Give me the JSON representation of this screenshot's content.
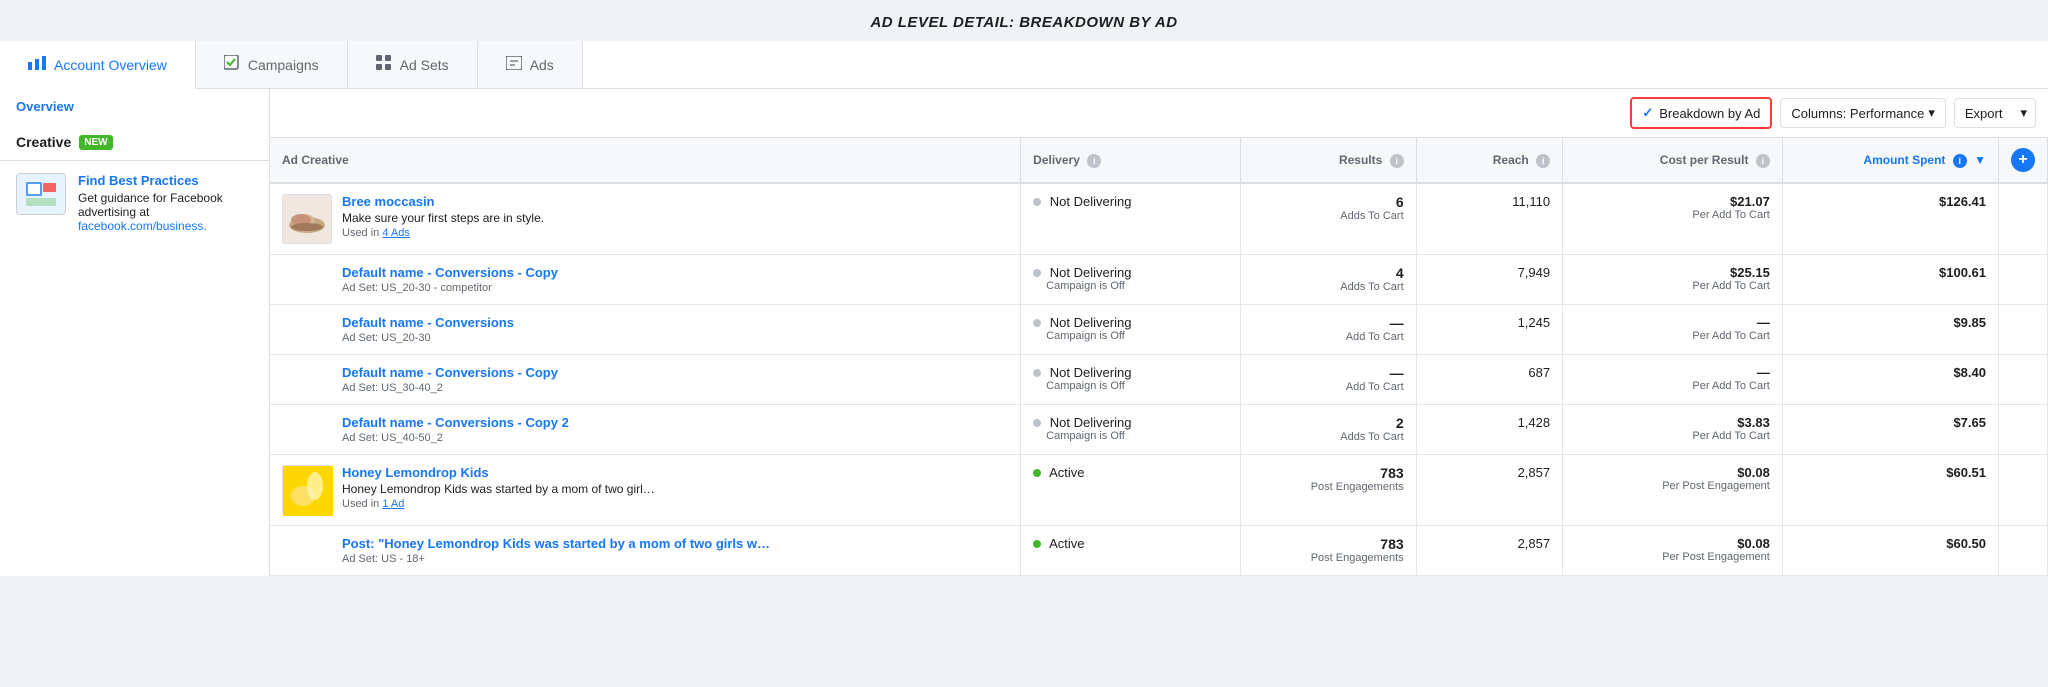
{
  "page": {
    "title": "AD LEVEL DETAIL: BREAKDOWN BY AD"
  },
  "nav": {
    "tabs": [
      {
        "id": "account-overview",
        "label": "Account Overview",
        "icon": "chart-icon",
        "active": true
      },
      {
        "id": "campaigns",
        "label": "Campaigns",
        "icon": "check-icon"
      },
      {
        "id": "ad-sets",
        "label": "Ad Sets",
        "icon": "grid-icon"
      },
      {
        "id": "ads",
        "label": "Ads",
        "icon": "ad-icon"
      }
    ]
  },
  "sidebar": {
    "overview_label": "Overview",
    "creative_label": "Creative",
    "creative_badge": "NEW",
    "find_best": {
      "title": "Find Best Practices",
      "desc1": "Get guidance for",
      "desc2": "Facebook advertising at",
      "link": "facebook.com/business."
    }
  },
  "toolbar": {
    "breakdown_label": "Breakdown by Ad",
    "columns_label": "Columns: Performance",
    "export_label": "Export"
  },
  "table": {
    "headers": [
      {
        "id": "ad-creative",
        "label": "Ad Creative",
        "info": false,
        "sortable": false
      },
      {
        "id": "delivery",
        "label": "Delivery",
        "info": true,
        "sortable": false
      },
      {
        "id": "results",
        "label": "Results",
        "info": true,
        "sortable": false
      },
      {
        "id": "reach",
        "label": "Reach",
        "info": true,
        "sortable": false
      },
      {
        "id": "cost-per-result",
        "label": "Cost per Result",
        "info": true,
        "sortable": false
      },
      {
        "id": "amount-spent",
        "label": "Amount Spent",
        "info": true,
        "sortable": true,
        "active": true
      }
    ],
    "rows": [
      {
        "id": "row-1",
        "thumb_type": "shoe",
        "ad_name": "Bree moccasin",
        "ad_desc": "Make sure your first steps are in style.",
        "ad_sub": "Used in 4 Ads",
        "ad_sub_link": true,
        "delivery_status": "Not Delivering",
        "delivery_sub": "",
        "delivery_dot": "gray",
        "results_num": "6",
        "results_type": "Adds To Cart",
        "reach": "11,110",
        "cost_main": "$21.07",
        "cost_sub": "Per Add To Cart",
        "amount": "$126.41"
      },
      {
        "id": "row-2",
        "thumb_type": "none",
        "ad_name": "Default name - Conversions - Copy",
        "ad_desc": "",
        "ad_sub": "Ad Set: US_20-30 - competitor",
        "ad_sub_link": false,
        "delivery_status": "Not Delivering",
        "delivery_sub": "Campaign is Off",
        "delivery_dot": "gray",
        "results_num": "4",
        "results_type": "Adds To Cart",
        "reach": "7,949",
        "cost_main": "$25.15",
        "cost_sub": "Per Add To Cart",
        "amount": "$100.61"
      },
      {
        "id": "row-3",
        "thumb_type": "none",
        "ad_name": "Default name - Conversions",
        "ad_desc": "",
        "ad_sub": "Ad Set: US_20-30",
        "ad_sub_link": false,
        "delivery_status": "Not Delivering",
        "delivery_sub": "Campaign is Off",
        "delivery_dot": "gray",
        "results_num": "—",
        "results_type": "Add To Cart",
        "reach": "1,245",
        "cost_main": "—",
        "cost_sub": "Per Add To Cart",
        "amount": "$9.85"
      },
      {
        "id": "row-4",
        "thumb_type": "none",
        "ad_name": "Default name - Conversions - Copy",
        "ad_desc": "",
        "ad_sub": "Ad Set: US_30-40_2",
        "ad_sub_link": false,
        "delivery_status": "Not Delivering",
        "delivery_sub": "Campaign is Off",
        "delivery_dot": "gray",
        "results_num": "—",
        "results_type": "Add To Cart",
        "reach": "687",
        "cost_main": "—",
        "cost_sub": "Per Add To Cart",
        "amount": "$8.40"
      },
      {
        "id": "row-5",
        "thumb_type": "none",
        "ad_name": "Default name - Conversions - Copy 2",
        "ad_desc": "",
        "ad_sub": "Ad Set: US_40-50_2",
        "ad_sub_link": false,
        "delivery_status": "Not Delivering",
        "delivery_sub": "Campaign is Off",
        "delivery_dot": "gray",
        "results_num": "2",
        "results_type": "Adds To Cart",
        "reach": "1,428",
        "cost_main": "$3.83",
        "cost_sub": "Per Add To Cart",
        "amount": "$7.65"
      },
      {
        "id": "row-6",
        "thumb_type": "yellow",
        "ad_name": "Honey Lemondrop Kids",
        "ad_desc": "Honey Lemondrop Kids was started by a mom of two girl…",
        "ad_sub": "Used in 1 Ad",
        "ad_sub_link": true,
        "delivery_status": "Active",
        "delivery_sub": "",
        "delivery_dot": "green",
        "results_num": "783",
        "results_type": "Post Engagements",
        "reach": "2,857",
        "cost_main": "$0.08",
        "cost_sub": "Per Post Engagement",
        "amount": "$60.51"
      },
      {
        "id": "row-7",
        "thumb_type": "none",
        "ad_name": "Post: \"Honey Lemondrop Kids was started by a mom of two girls w…",
        "ad_desc": "",
        "ad_sub": "Ad Set: US - 18+",
        "ad_sub_link": false,
        "delivery_status": "Active",
        "delivery_sub": "",
        "delivery_dot": "green",
        "results_num": "783",
        "results_type": "Post Engagements",
        "reach": "2,857",
        "cost_main": "$0.08",
        "cost_sub": "Per Post Engagement",
        "amount": "$60.50"
      }
    ]
  }
}
